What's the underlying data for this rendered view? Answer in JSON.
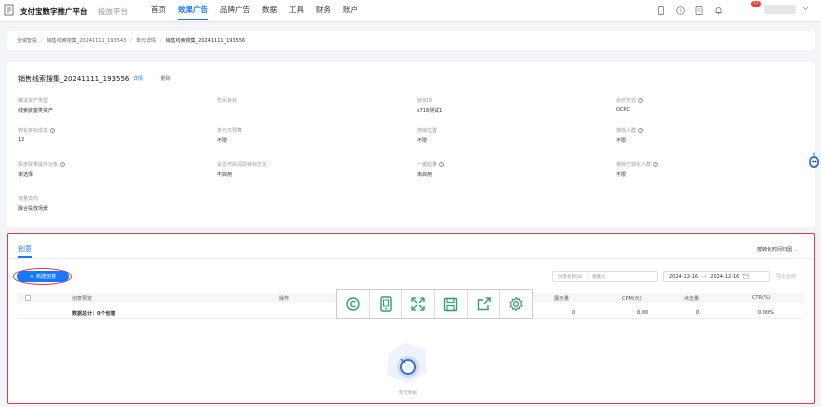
{
  "topbar": {
    "brand": "支付宝数字推广平台",
    "brand_sub": "投放平台",
    "nav": [
      "首页",
      "效果广告",
      "品牌广告",
      "数据",
      "工具",
      "财务",
      "账户"
    ],
    "active_index": 1,
    "notification_count": "11"
  },
  "breadcrumb": [
    "全域智投",
    "销售线索搜集_20241111_193543",
    "单元详情",
    "销售线索搜集_20241111_193556"
  ],
  "plan": {
    "title": "销售线索搜集_20241111_193556",
    "detail_link": "详情",
    "delete_label": "删除"
  },
  "fields": [
    {
      "label": "推进资产类型",
      "value": "线索获客类资产",
      "help": false
    },
    {
      "label": "优化目标",
      "value": "",
      "help": false
    },
    {
      "label": "转化ID",
      "value": "s718测试1",
      "help": false
    },
    {
      "label": "出价方式",
      "value": "OCPC",
      "help": true
    },
    {
      "label": "转化目标成本",
      "value": "12",
      "help": true
    },
    {
      "label": "单元日预算",
      "value": "不限",
      "help": false
    },
    {
      "label": "地域位置",
      "value": "不限",
      "help": false
    },
    {
      "label": "排除人群",
      "value": "不限",
      "help": true
    },
    {
      "label": "投放效果提升对象",
      "value": "未选择",
      "help": true
    },
    {
      "label": "是否开启深层目标优化",
      "value": "不启用",
      "help": false
    },
    {
      "label": "一键起量",
      "value": "未启用",
      "help": true
    },
    {
      "label": "排除已转化人群",
      "value": "不限",
      "help": true
    },
    {
      "label": "流量去向",
      "value": "融合投放场景",
      "help": false
    }
  ],
  "creative": {
    "tab_label": "创意",
    "time_dropdown": "按转化时间归因",
    "new_button": "新建创意",
    "search_label": "创意名称/ID",
    "search_placeholder": "请输入",
    "date_start": "2024-12-16",
    "date_end": "2024-12-16",
    "export_label": "导出全部",
    "columns": [
      "创意预览",
      "操作",
      "展示量",
      "CPM(元)",
      "点击量",
      "CTR(%)"
    ],
    "summary_row": {
      "label": "数据总计：0个创意",
      "impressions": "0",
      "cpm": "0.00",
      "clicks": "0",
      "ctr": "0.00%"
    },
    "empty_text": "暂无数据"
  },
  "toolbar": {
    "icons": [
      "copyright-icon",
      "tablet-icon",
      "expand-icon",
      "save-icon",
      "share-icon",
      "settings-icon"
    ],
    "color": "#2ea06b"
  },
  "colors": {
    "accent": "#1677ff",
    "highlight_border": "#e4393c"
  }
}
